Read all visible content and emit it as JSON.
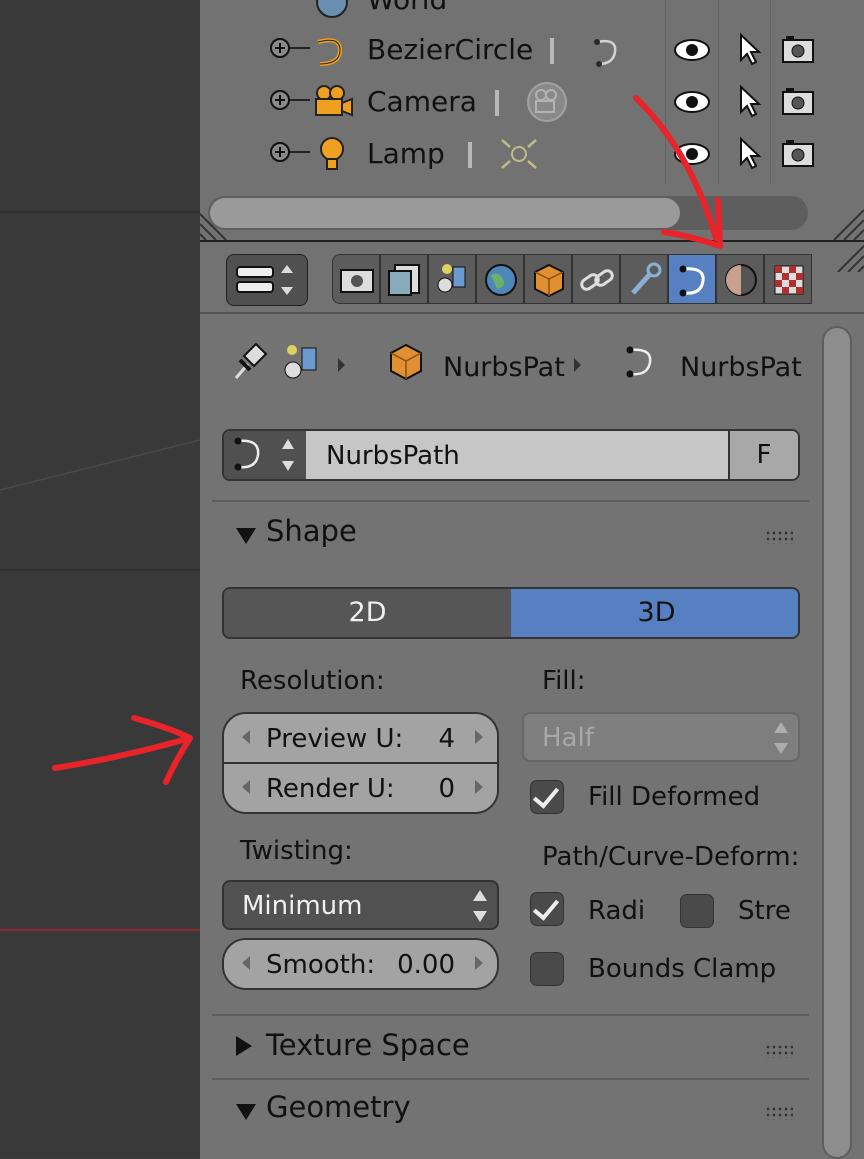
{
  "outliner": {
    "top_item": "World",
    "rows": [
      {
        "label": "BezierCircle"
      },
      {
        "label": "Camera"
      },
      {
        "label": "Lamp"
      }
    ]
  },
  "properties": {
    "breadcrumb": {
      "object": "NurbsPat",
      "data": "NurbsPat"
    },
    "datablock": {
      "name": "NurbsPath",
      "fake_user": "F"
    },
    "shape_panel": {
      "title": "Shape",
      "dim_2d": "2D",
      "dim_3d": "3D",
      "active_dimension": "3D",
      "resolution_label": "Resolution:",
      "preview_u": {
        "label": "Preview U:",
        "value": "4"
      },
      "render_u": {
        "label": "Render U:",
        "value": "0"
      },
      "fill_label": "Fill:",
      "fill_value": "Half",
      "fill_deformed": {
        "label": "Fill Deformed",
        "checked": true
      },
      "twisting_label": "Twisting:",
      "twisting_value": "Minimum",
      "smooth": {
        "label": "Smooth:",
        "value": "0.00"
      },
      "path_deform_label": "Path/Curve-Deform:",
      "radius": {
        "label": "Radi",
        "checked": true
      },
      "stretch": {
        "label": "Stre",
        "checked": false
      },
      "bounds_clamp": {
        "label": "Bounds Clamp",
        "checked": false
      }
    },
    "texture_space_panel": {
      "title": "Texture Space"
    },
    "geometry_panel": {
      "title": "Geometry"
    }
  },
  "colors": {
    "accent": "#5680c2",
    "annotation": "#e8232a",
    "panel_bg": "#737373"
  }
}
